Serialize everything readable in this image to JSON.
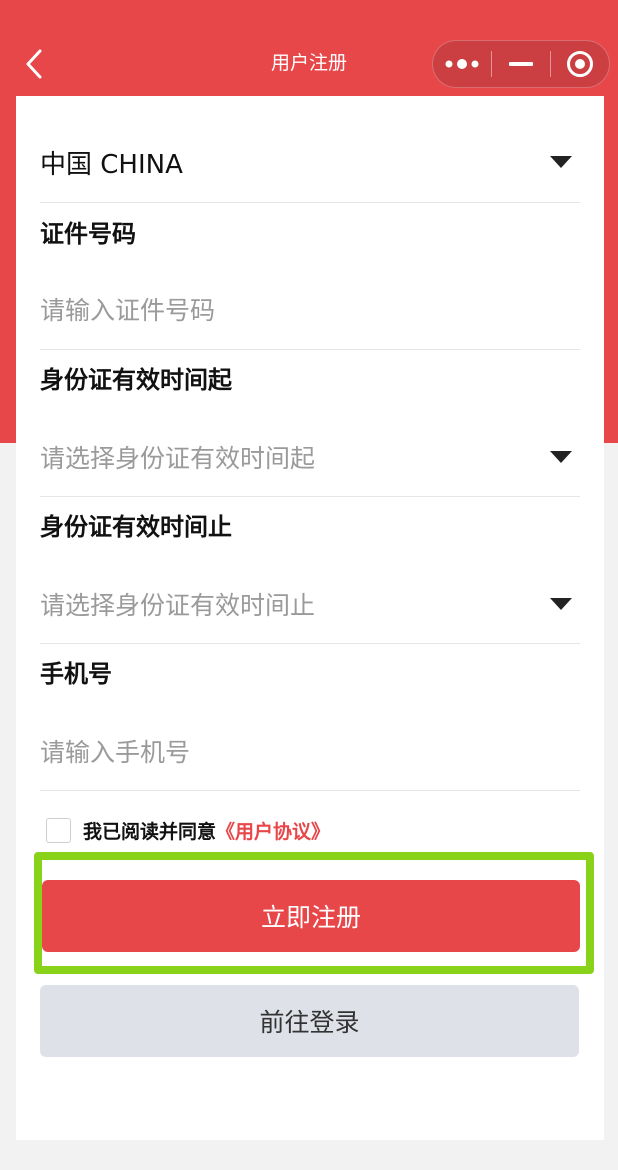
{
  "navbar": {
    "title": "用户注册"
  },
  "form": {
    "country_value": "中国 CHINA",
    "id_number": {
      "label": "证件号码",
      "placeholder": "请输入证件号码"
    },
    "id_valid_start": {
      "label": "身份证有效时间起",
      "placeholder": "请选择身份证有效时间起"
    },
    "id_valid_end": {
      "label": "身份证有效时间止",
      "placeholder": "请选择身份证有效时间止"
    },
    "phone": {
      "label": "手机号",
      "placeholder": "请输入手机号"
    }
  },
  "agreement": {
    "text": "我已阅读并同意",
    "link": "《用户协议》"
  },
  "buttons": {
    "register": "立即注册",
    "login": "前往登录"
  },
  "colors": {
    "primary": "#e8474a",
    "highlight": "#88d21a",
    "secondary_button": "#dfe1e8"
  },
  "icons": {
    "back": "chevron-left-icon",
    "more": "more-dots-icon",
    "minimize": "minimize-icon",
    "close": "target-circle-icon",
    "dropdown": "caret-down-icon"
  }
}
